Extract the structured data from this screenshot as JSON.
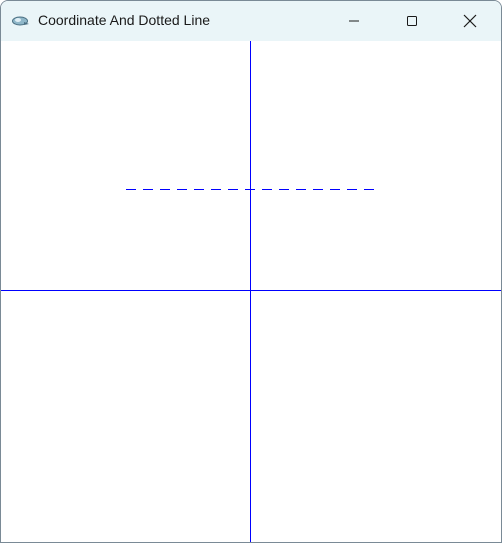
{
  "window": {
    "title": "Coordinate And Dotted Line",
    "controls": {
      "minimize_icon": "minimize-icon",
      "maximize_icon": "maximize-icon",
      "close_icon": "close-icon"
    }
  },
  "canvas": {
    "line_color": "#0000ff",
    "axes": [
      "x-axis",
      "y-axis"
    ],
    "dotted_line": {
      "style": "dashed"
    }
  },
  "colors": {
    "titlebar_bg": "#eaf5f8",
    "canvas_bg": "#ffffff",
    "line": "#0000ff"
  }
}
